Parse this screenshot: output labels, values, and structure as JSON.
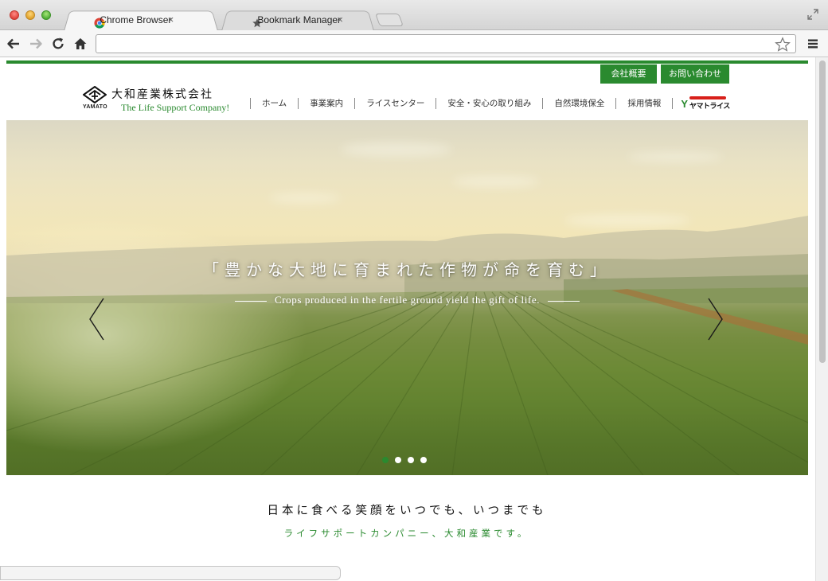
{
  "browser": {
    "tabs": [
      {
        "label": "Chrome Browser",
        "active": true,
        "icon": "chrome-icon"
      },
      {
        "label": "Bookmark Manager",
        "active": false,
        "icon": "star-icon"
      }
    ],
    "tab_close_glyph": "×",
    "address": {
      "value": "",
      "placeholder": ""
    }
  },
  "site": {
    "logo": {
      "jp": "大和産業株式会社",
      "en": "The Life Support Company!",
      "mark_text": "YAMATO"
    },
    "top_buttons": [
      "会社概要",
      "お問い合わせ"
    ],
    "nav": [
      "ホーム",
      "事業案内",
      "ライスセンター",
      "安全・安心の取り組み",
      "自然環境保全",
      "採用情報"
    ],
    "brand": {
      "y": "Y",
      "text": "ヤマトライス"
    },
    "hero": {
      "title": "「豊かな大地に育まれた作物が命を育む」",
      "subtitle": "Crops produced in the fertile ground yield the gift of life.",
      "slides_count": 4,
      "active_slide": 0
    },
    "tagline": {
      "main": "日本に食べる笑顔をいつでも、いつまでも",
      "sub": "ライフサポートカンパニー、大和産業です。"
    }
  },
  "colors": {
    "brand_green": "#2a8a2f",
    "brand_red": "#d8201a"
  }
}
